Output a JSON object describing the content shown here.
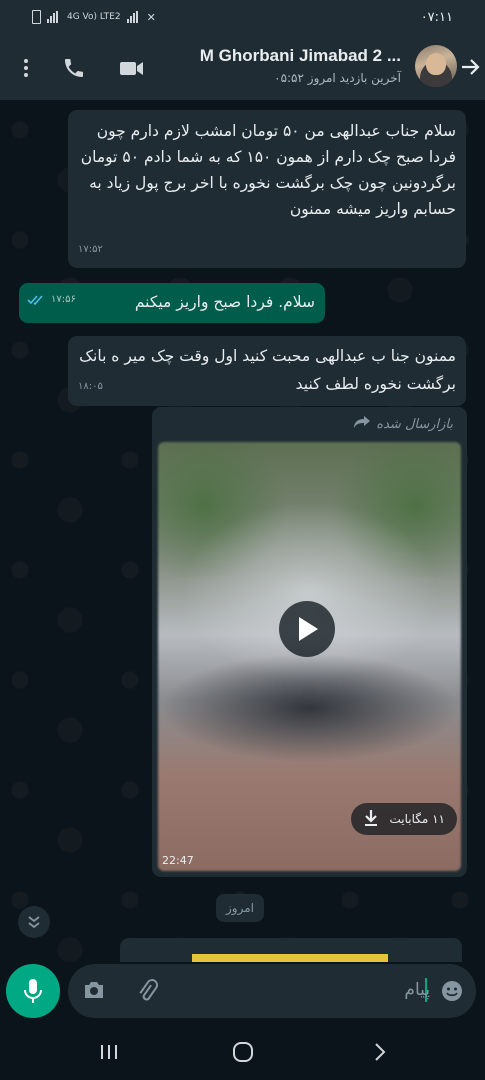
{
  "status_bar": {
    "time": "۰۷:۱۱",
    "network": "4G Vo) LTE2"
  },
  "header": {
    "contact_name": "M Ghorbani Jimabad 2 ...",
    "last_seen": "آخرین بازدید امروز ۰۵:۵۲"
  },
  "messages": [
    {
      "direction": "in",
      "text": "سلام جناب عبدالهی من ۵۰ تومان امشب لازم دارم چون فردا صبح چک دارم از همون ۱۵۰ که به شما دادم ۵۰ تومان برگردونین چون چک برگشت نخوره با اخر برج پول زیاد به حسابم واریز میشه ممنون",
      "time": "۱۷:۵۲"
    },
    {
      "direction": "out",
      "text": "سلام. فردا صبح واریز میکنم",
      "time": "۱۷:۵۶",
      "status": "read"
    },
    {
      "direction": "in",
      "text": "ممنون جنا ب عبدالهی محبت کنید اول وقت چک میر ه بانک برگشت نخوره لطف کنید",
      "time": "۱۸:۰۵"
    }
  ],
  "forwarded_video": {
    "forwarded_label": "بازارسال شده",
    "size": "۱۱ مگابایت",
    "duration": "22:47"
  },
  "date_separator": "امروز",
  "input": {
    "placeholder": "پیام"
  },
  "colors": {
    "accent": "#00a884",
    "outgoing_bubble": "#005c4b",
    "incoming_bubble": "#1f2c34",
    "background": "#0b141a"
  }
}
